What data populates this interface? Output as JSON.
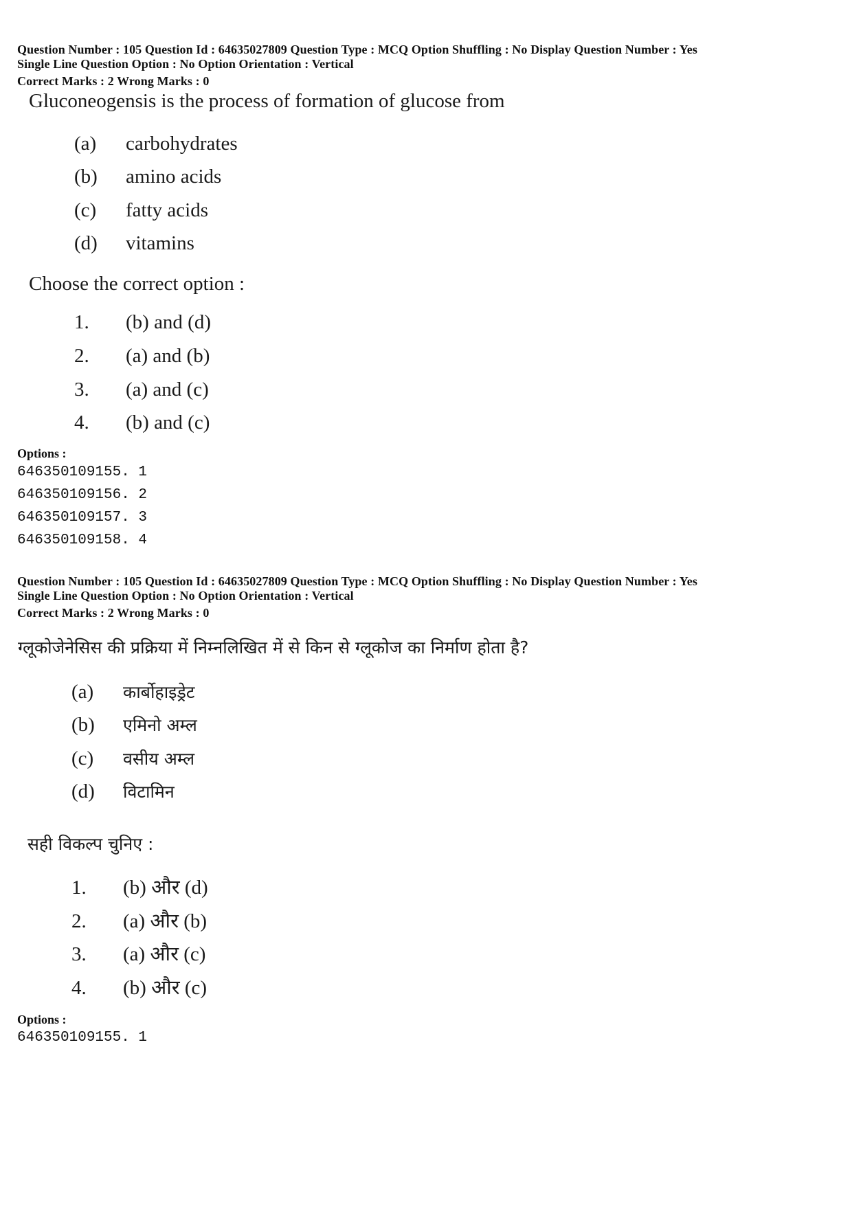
{
  "blocks": [
    {
      "meta_line1": "Question Number : 105  Question Id : 64635027809  Question Type : MCQ  Option Shuffling : No  Display Question Number : Yes",
      "meta_line2": "Single Line Question Option : No  Option Orientation : Vertical",
      "marks": "Correct Marks : 2  Wrong Marks : 0",
      "question": "Gluconeogensis is the process of formation of glucose from",
      "statements": [
        {
          "label": "(a)",
          "text": "carbohydrates"
        },
        {
          "label": "(b)",
          "text": "amino acids"
        },
        {
          "label": "(c)",
          "text": "fatty acids"
        },
        {
          "label": "(d)",
          "text": "vitamins"
        }
      ],
      "choose_prompt": "Choose the correct option :",
      "choices": [
        {
          "num": "1.",
          "text": "(b) and (d)"
        },
        {
          "num": "2.",
          "text": "(a) and (b)"
        },
        {
          "num": "3.",
          "text": "(a) and (c)"
        },
        {
          "num": "4.",
          "text": "(b) and (c)"
        }
      ],
      "options_heading": "Options :",
      "option_ids": [
        "646350109155. 1",
        "646350109156. 2",
        "646350109157. 3",
        "646350109158. 4"
      ]
    },
    {
      "meta_line1": "Question Number : 105  Question Id : 64635027809  Question Type : MCQ  Option Shuffling : No  Display Question Number : Yes",
      "meta_line2": "Single Line Question Option : No  Option Orientation : Vertical",
      "marks": "Correct Marks : 2  Wrong Marks : 0",
      "question": "ग्लूकोजेनेसिस की प्रक्रिया में निम्नलिखित में से किन से ग्लूकोज का निर्माण होता है?",
      "statements": [
        {
          "label": "(a)",
          "text": "कार्बोहाइड्रेट"
        },
        {
          "label": "(b)",
          "text": "एमिनो अम्ल"
        },
        {
          "label": "(c)",
          "text": "वसीय अम्ल"
        },
        {
          "label": "(d)",
          "text": "विटामिन"
        }
      ],
      "choose_prompt": "सही विकल्प चुनिए :",
      "choices": [
        {
          "num": "1.",
          "text": "(b) और (d)"
        },
        {
          "num": "2.",
          "text": "(a) और (b)"
        },
        {
          "num": "3.",
          "text": "(a) और (c)"
        },
        {
          "num": "4.",
          "text": "(b) और (c)"
        }
      ],
      "options_heading": "Options :",
      "option_ids": [
        "646350109155. 1"
      ]
    }
  ]
}
